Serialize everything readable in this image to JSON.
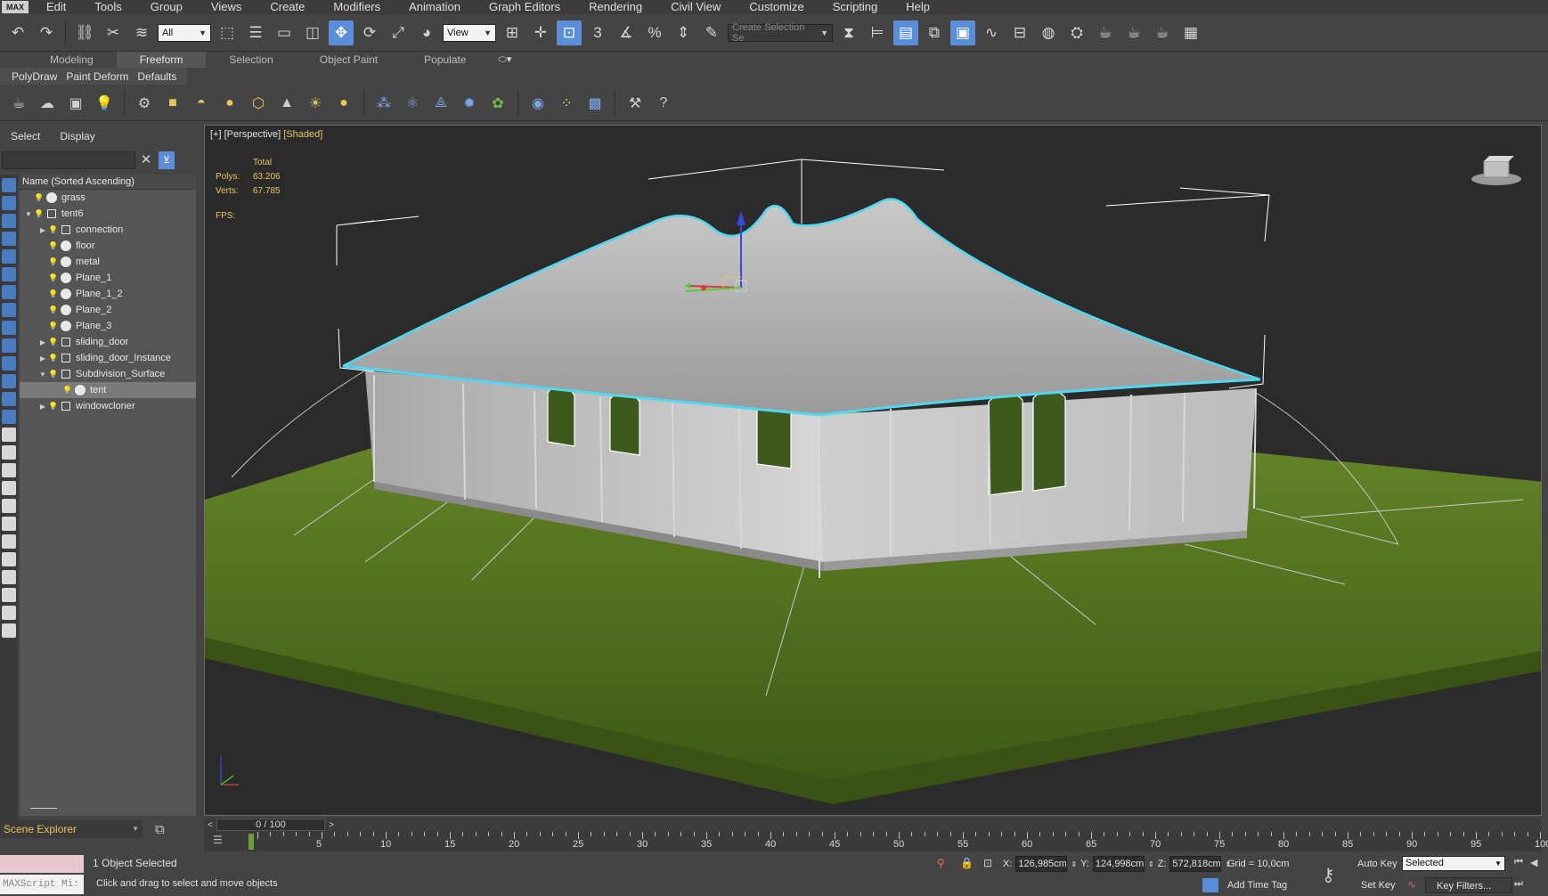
{
  "menu": {
    "logo": "MAX",
    "items": [
      "Edit",
      "Tools",
      "Group",
      "Views",
      "Create",
      "Modifiers",
      "Animation",
      "Graph Editors",
      "Rendering",
      "Civil View",
      "Customize",
      "Scripting",
      "Help"
    ]
  },
  "toolbar": {
    "filter_value": "All",
    "refcoord_value": "View",
    "selection_set_placeholder": "Create Selection Se"
  },
  "ribbon": {
    "tabs": [
      "Modeling",
      "Freeform",
      "Selection",
      "Object Paint",
      "Populate"
    ],
    "active_tab": "Freeform",
    "subtabs": [
      "PolyDraw",
      "Paint Deform",
      "Defaults"
    ]
  },
  "explorer": {
    "tabs": [
      "Select",
      "Display"
    ],
    "column_header": "Name (Sorted Ascending)",
    "rows": [
      {
        "name": "grass",
        "level": 0,
        "expander": ""
      },
      {
        "name": "tent6",
        "level": 0,
        "expander": "open"
      },
      {
        "name": "connection",
        "level": 1,
        "expander": "closed"
      },
      {
        "name": "floor",
        "level": 1,
        "expander": ""
      },
      {
        "name": "metal",
        "level": 1,
        "expander": ""
      },
      {
        "name": "Plane_1",
        "level": 1,
        "expander": ""
      },
      {
        "name": "Plane_1_2",
        "level": 1,
        "expander": ""
      },
      {
        "name": "Plane_2",
        "level": 1,
        "expander": ""
      },
      {
        "name": "Plane_3",
        "level": 1,
        "expander": ""
      },
      {
        "name": "sliding_door",
        "level": 1,
        "expander": "closed"
      },
      {
        "name": "sliding_door_Instance",
        "level": 1,
        "expander": "closed"
      },
      {
        "name": "Subdivision_Surface",
        "level": 1,
        "expander": "open"
      },
      {
        "name": "tent",
        "level": 2,
        "expander": "",
        "selected": true
      },
      {
        "name": "windowcloner",
        "level": 1,
        "expander": "closed"
      }
    ],
    "footer_label": "Scene Explorer"
  },
  "viewport": {
    "label_plus": "[+]",
    "label_view": "[Perspective]",
    "label_shading": "[Shaded]",
    "stats_header": "Total",
    "polys_label": "Polys:",
    "polys_value": "63.206",
    "verts_label": "Verts:",
    "verts_value": "67.785",
    "fps_label": "FPS:"
  },
  "timeline": {
    "frame_display": "0 / 100",
    "ticks": [
      "5",
      "10",
      "15",
      "20",
      "25",
      "30",
      "35",
      "40",
      "45",
      "50",
      "55",
      "60",
      "65",
      "70",
      "75",
      "80",
      "85",
      "90",
      "95",
      "100"
    ]
  },
  "status": {
    "maxscript_label": "MAXScript Mi:",
    "selection_text": "1 Object Selected",
    "prompt_text": "Click and drag to select and move objects",
    "x_label": "X:",
    "x_value": "126,985cm",
    "y_label": "Y:",
    "y_value": "124,998cm",
    "z_label": "Z:",
    "z_value": "572,818cm",
    "grid_text": "Grid = 10,0cm",
    "add_time_tag": "Add Time Tag",
    "auto_key": "Auto Key",
    "set_key": "Set Key",
    "selected_dropdown": "Selected",
    "key_filters": "Key Filters..."
  },
  "colors": {
    "accent_blue": "#5a8ed8",
    "stats_yellow": "#e6c65a",
    "selection_cyan": "#4fd8f0"
  }
}
